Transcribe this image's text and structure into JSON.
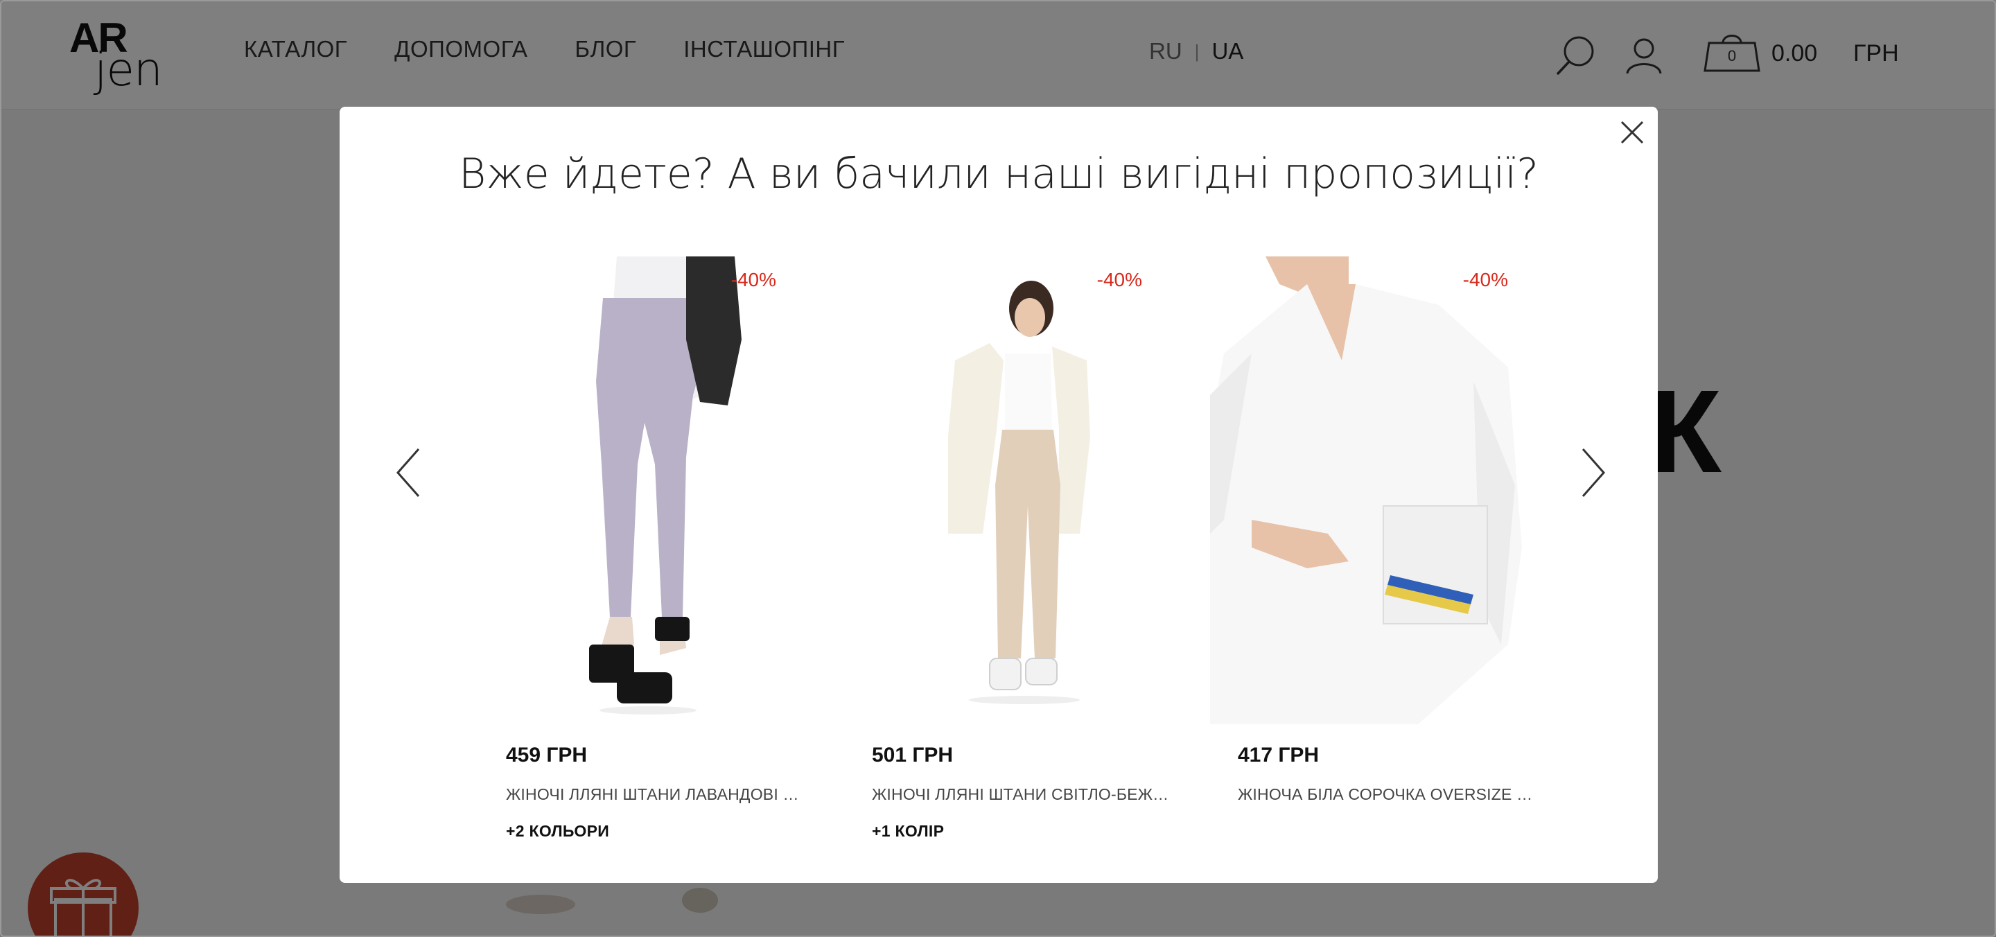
{
  "header": {
    "logo_top": "AR",
    "logo_bottom": "jen",
    "nav": [
      {
        "label": "КАТАЛОГ"
      },
      {
        "label": "ДОПОМОГА"
      },
      {
        "label": "БЛОГ"
      },
      {
        "label": "ІНСТАШОПІНГ"
      }
    ],
    "lang_ru": "RU",
    "lang_sep": "|",
    "lang_ua": "UA",
    "cart_count": "0",
    "cart_total": "0.00",
    "currency": "ГРН",
    "icons": [
      "search-icon",
      "user-icon",
      "cart-icon"
    ]
  },
  "background": {
    "partial_heading_letter": "К"
  },
  "modal": {
    "title": "Вже йдете? А ви бачили наші вигідні пропозиції?",
    "icons": [
      "close-icon",
      "chevron-left-icon",
      "chevron-right-icon"
    ],
    "products": [
      {
        "badge": "-40%",
        "price": "459 ГРН",
        "name": "ЖІНОЧІ ЛЛЯНІ ШТАНИ ЛАВАНДОВІ З А...",
        "colors": "+2 КОЛЬОРИ"
      },
      {
        "badge": "-40%",
        "price": "501 ГРН",
        "name": "ЖІНОЧІ ЛЛЯНІ ШТАНИ СВІТЛО-БЕЖЕВІ...",
        "colors": "+1 КОЛІР"
      },
      {
        "badge": "-40%",
        "price": "417 ГРН",
        "name": "ЖІНОЧА БІЛА СОРОЧКА OVERSIZE ІЗ С...",
        "colors": ""
      }
    ]
  },
  "colors": {
    "accent_badge": "#d9291c",
    "gift_button": "#c0402d",
    "overlay": "rgba(0,0,0,0.5)"
  }
}
